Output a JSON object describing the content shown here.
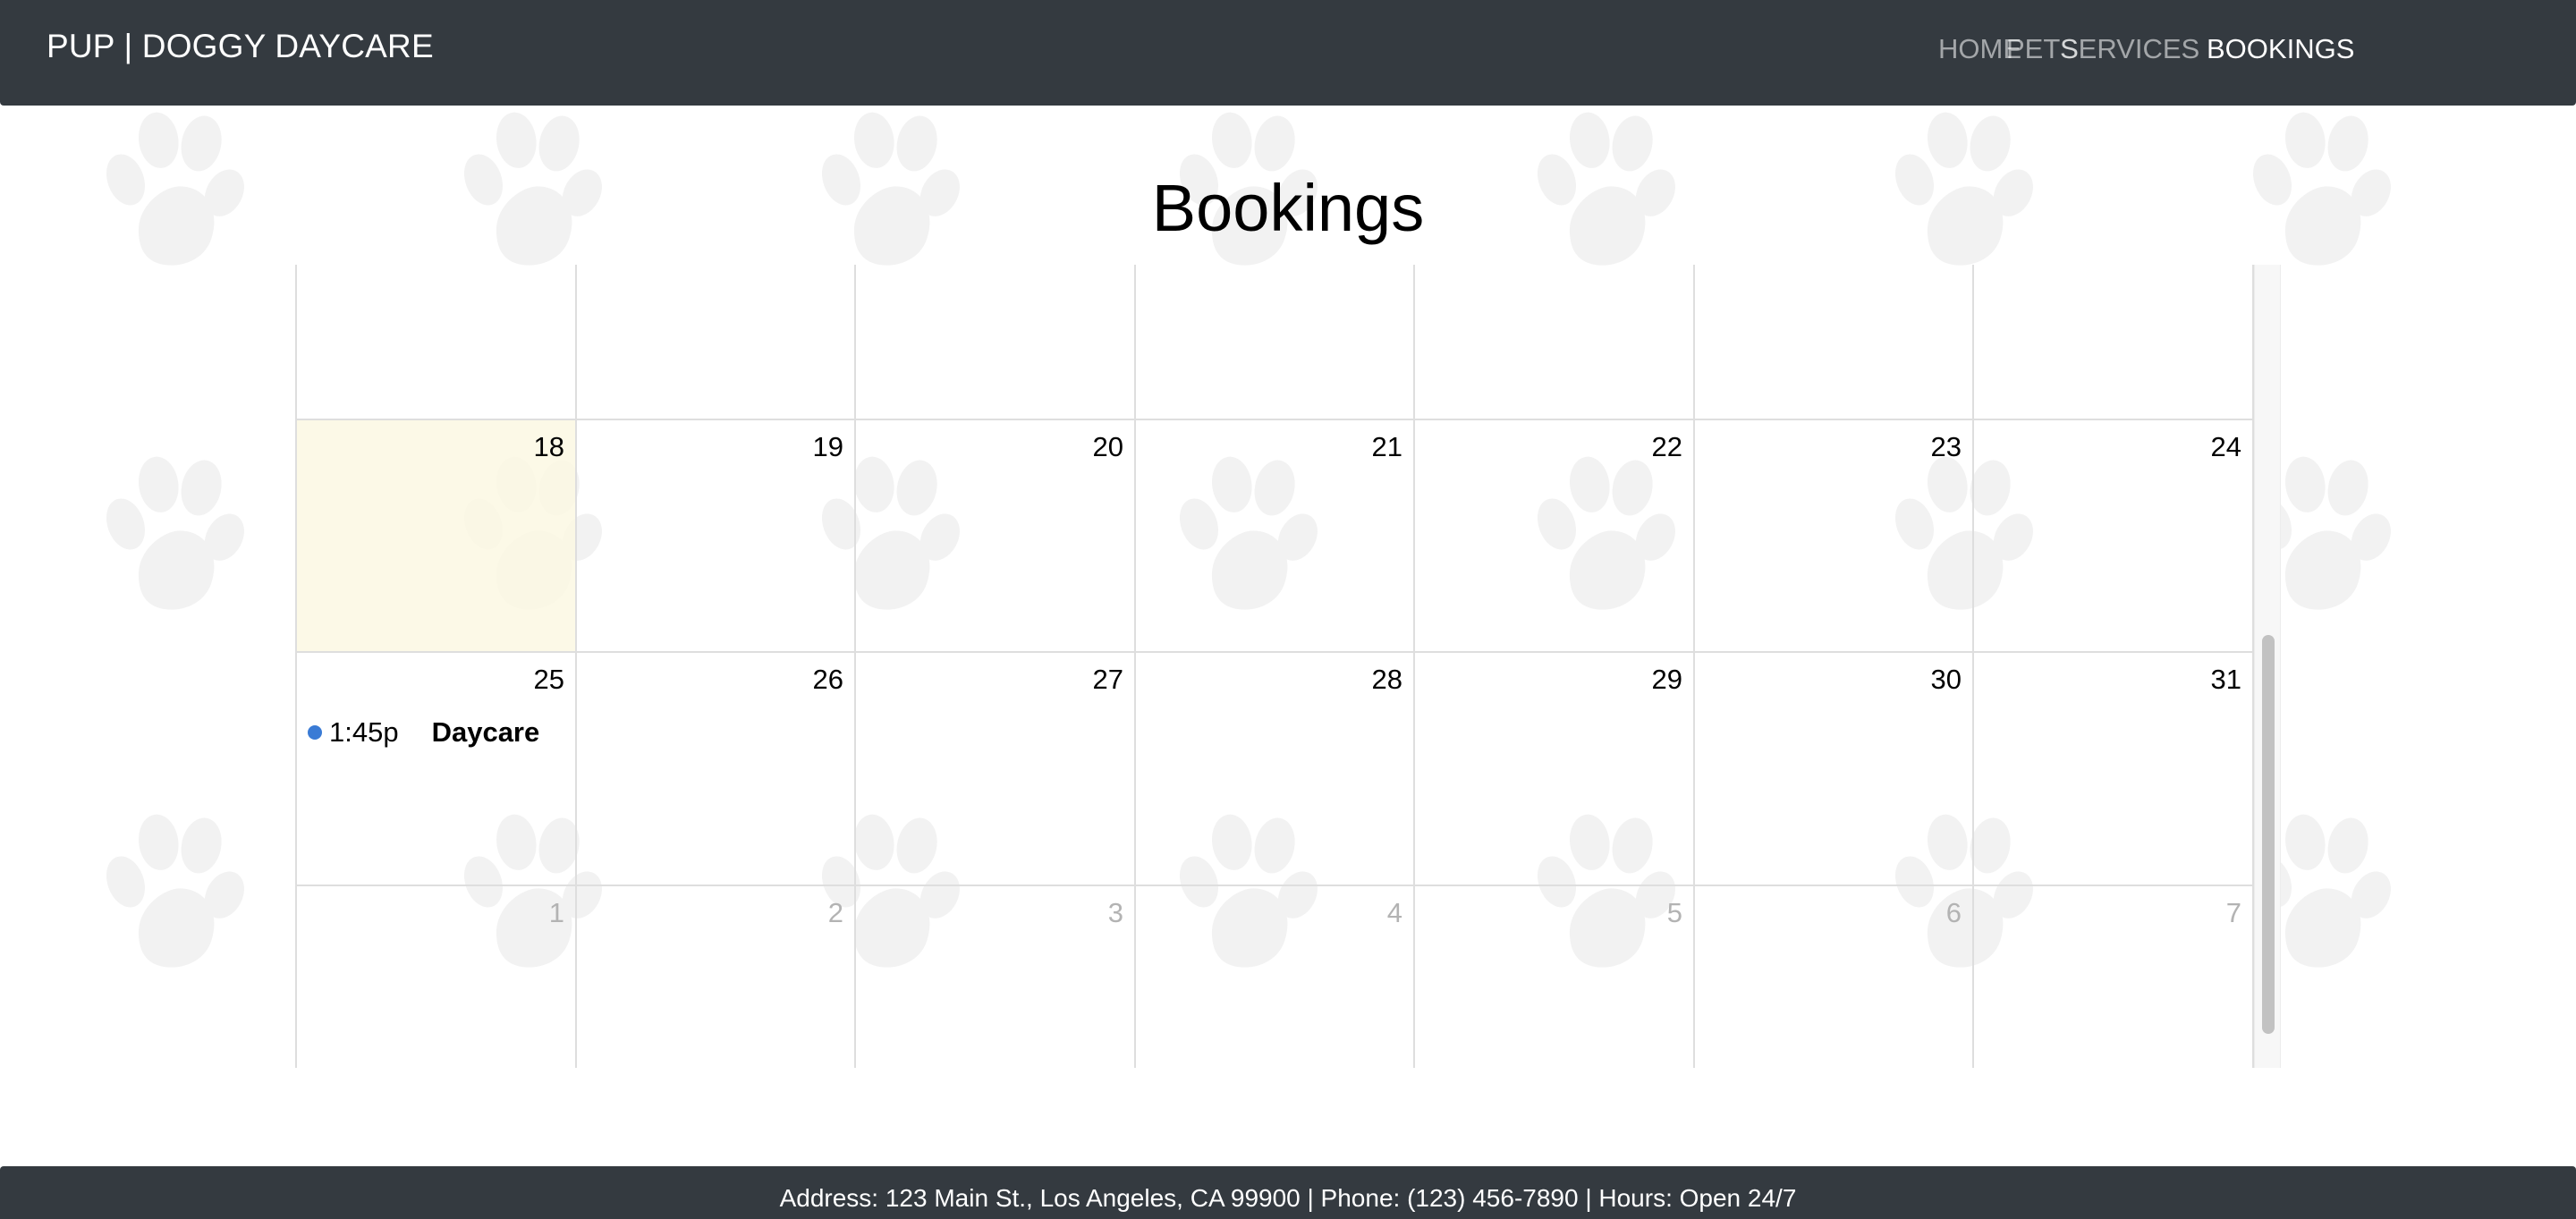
{
  "navbar": {
    "brand": "PUP | DOGGY DAYCARE",
    "links": [
      {
        "label": "HOME",
        "active": false
      },
      {
        "label": "PETS",
        "active": false
      },
      {
        "label": "SERVICES",
        "active": false
      },
      {
        "label": "BOOKINGS",
        "active": true
      }
    ]
  },
  "page": {
    "title": "Bookings"
  },
  "calendar": {
    "weeks": [
      {
        "days": []
      },
      {
        "days": [
          {
            "label": "18",
            "today": true
          },
          {
            "label": "19"
          },
          {
            "label": "20"
          },
          {
            "label": "21"
          },
          {
            "label": "22"
          },
          {
            "label": "23"
          },
          {
            "label": "24"
          }
        ]
      },
      {
        "days": [
          {
            "label": "25"
          },
          {
            "label": "26"
          },
          {
            "label": "27"
          },
          {
            "label": "28"
          },
          {
            "label": "29"
          },
          {
            "label": "30"
          },
          {
            "label": "31"
          }
        ]
      },
      {
        "days": [
          {
            "label": "1",
            "other_month": true
          },
          {
            "label": "2",
            "other_month": true
          },
          {
            "label": "3",
            "other_month": true
          },
          {
            "label": "4",
            "other_month": true
          },
          {
            "label": "5",
            "other_month": true
          },
          {
            "label": "6",
            "other_month": true
          },
          {
            "label": "7",
            "other_month": true
          }
        ]
      }
    ],
    "events": [
      {
        "day": "25",
        "time": "1:45p",
        "title": "Daycare",
        "dot_color": "#3a7bd5"
      }
    ],
    "today_highlight_color": "#fcf8e3"
  },
  "footer": {
    "text": "Address: 123 Main St., Los Angeles, CA 99900 | Phone: (123) 456-7890 | Hours: Open 24/7"
  },
  "colors": {
    "navbar_bg": "#343a40",
    "footer_bg": "#343a40",
    "nav_link_inactive": "rgba(255,255,255,0.55)",
    "nav_link_active": "#ffffff",
    "paw_color": "#f2f2f2"
  }
}
